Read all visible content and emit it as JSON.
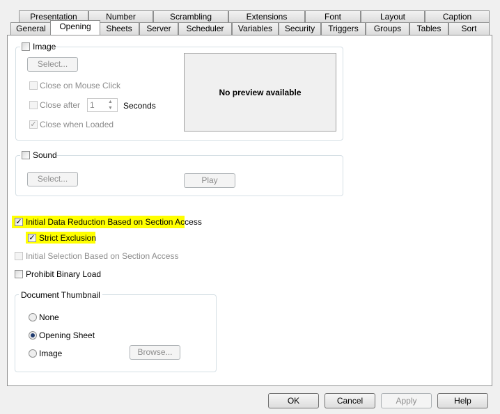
{
  "tabs_top": [
    "Presentation",
    "Number",
    "Scrambling",
    "Extensions",
    "Font",
    "Layout",
    "Caption"
  ],
  "tabs_bottom": [
    "General",
    "Opening",
    "Sheets",
    "Server",
    "Scheduler",
    "Variables",
    "Security",
    "Triggers",
    "Groups",
    "Tables",
    "Sort"
  ],
  "selected_tab": "Opening",
  "image": {
    "label": "Image",
    "checked": false,
    "select_label": "Select...",
    "close_on_click": "Close on Mouse Click",
    "close_after": "Close after",
    "seconds_value": "1",
    "seconds_label": "Seconds",
    "close_when_loaded": "Close when Loaded",
    "preview": "No preview available"
  },
  "sound": {
    "label": "Sound",
    "checked": false,
    "select_label": "Select...",
    "play_label": "Play"
  },
  "initial_data_reduction": {
    "label": "Initial Data Reduction Based on Section Access",
    "checked": true
  },
  "strict_exclusion": {
    "label": "Strict Exclusion",
    "checked": true
  },
  "initial_selection": {
    "label": "Initial Selection Based on Section Access",
    "checked": false
  },
  "prohibit_binary": {
    "label": "Prohibit Binary Load",
    "checked": false
  },
  "thumbnail": {
    "title": "Document Thumbnail",
    "options": [
      "None",
      "Opening Sheet",
      "Image"
    ],
    "selected": "Opening Sheet",
    "browse_label": "Browse..."
  },
  "footer": {
    "ok": "OK",
    "cancel": "Cancel",
    "apply": "Apply",
    "help": "Help"
  },
  "highlight_color": "#ffff00"
}
